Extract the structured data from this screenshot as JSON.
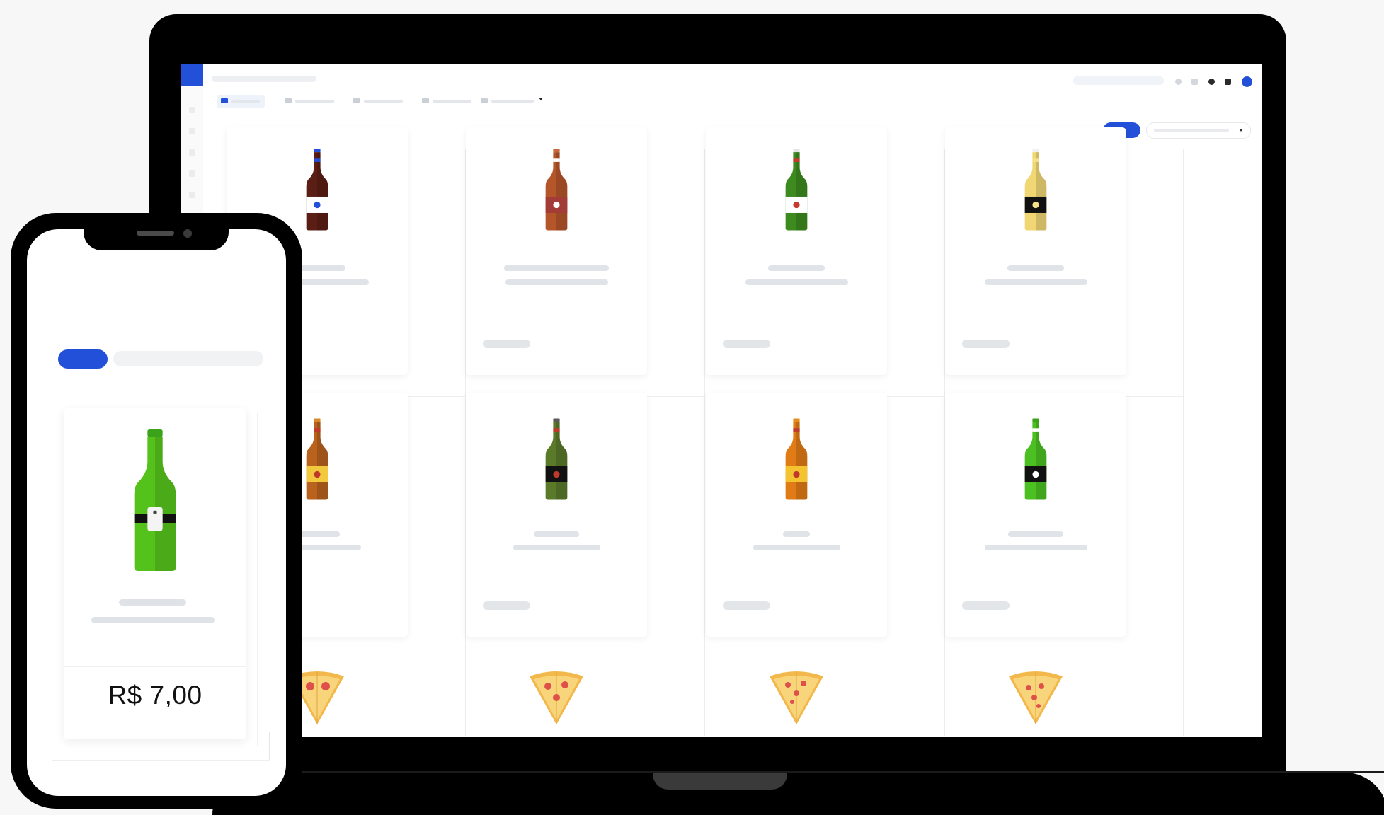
{
  "products": [
    {
      "icon": "beer-bottle-dark-brown-icon",
      "colors": {
        "body": "#5a1e14",
        "label": "#ffffff",
        "band": "#2350d8",
        "cap": "#2350d8"
      }
    },
    {
      "icon": "beer-bottle-amber-icon",
      "colors": {
        "body": "#b5552a",
        "label": "#a33b37",
        "band": "#ffffff",
        "cap": "#c9673a"
      }
    },
    {
      "icon": "beer-bottle-green-icon",
      "colors": {
        "body": "#3d8a1f",
        "label": "#ffffff",
        "band": "#c53a2c",
        "cap": "#e5e5e5"
      }
    },
    {
      "icon": "beer-bottle-clear-icon",
      "colors": {
        "body": "#f0d774",
        "label": "#111111",
        "band": "#f5e08a",
        "cap": "#f1f1f1"
      }
    },
    {
      "icon": "beer-bottle-brown-yellow-icon",
      "colors": {
        "body": "#b8621d",
        "label": "#f2c83c",
        "band": "#c0392b",
        "cap": "#d98a2c"
      }
    },
    {
      "icon": "beer-bottle-olive-icon",
      "colors": {
        "body": "#5a7a2a",
        "label": "#111111",
        "band": "#c0392b",
        "cap": "#5a5a5a"
      }
    },
    {
      "icon": "beer-bottle-orange-icon",
      "colors": {
        "body": "#e07b15",
        "label": "#f4c430",
        "band": "#c0392b",
        "cap": "#e58e1a"
      }
    },
    {
      "icon": "beer-bottle-bright-green-icon",
      "colors": {
        "body": "#4cbf22",
        "label": "#111111",
        "band": "#ffffff",
        "cap": "#3aa31a"
      }
    },
    {
      "icon": "pizza-slice-pepperoni-icon",
      "colors": {
        "crust": "#f2b84b",
        "cheese": "#f8d57a",
        "topping": "#e0504a"
      }
    },
    {
      "icon": "pizza-slice-veggie-icon",
      "colors": {
        "crust": "#f2b84b",
        "cheese": "#f8d57a",
        "topping": "#e0504a"
      }
    },
    {
      "icon": "pizza-slice-supreme-icon",
      "colors": {
        "crust": "#f2b84b",
        "cheese": "#f8d57a",
        "topping": "#e0504a"
      }
    },
    {
      "icon": "pizza-slice-mushroom-icon",
      "colors": {
        "crust": "#f2b84b",
        "cheese": "#f8d57a",
        "topping": "#e0504a"
      }
    }
  ],
  "phone": {
    "product": {
      "icon": "beer-bottle-green-icon",
      "colors": {
        "body": "#55c21b",
        "label": "#111111"
      }
    },
    "price": "R$ 7,00"
  },
  "theme": {
    "accent": "#2350d8",
    "device": "#000000"
  }
}
